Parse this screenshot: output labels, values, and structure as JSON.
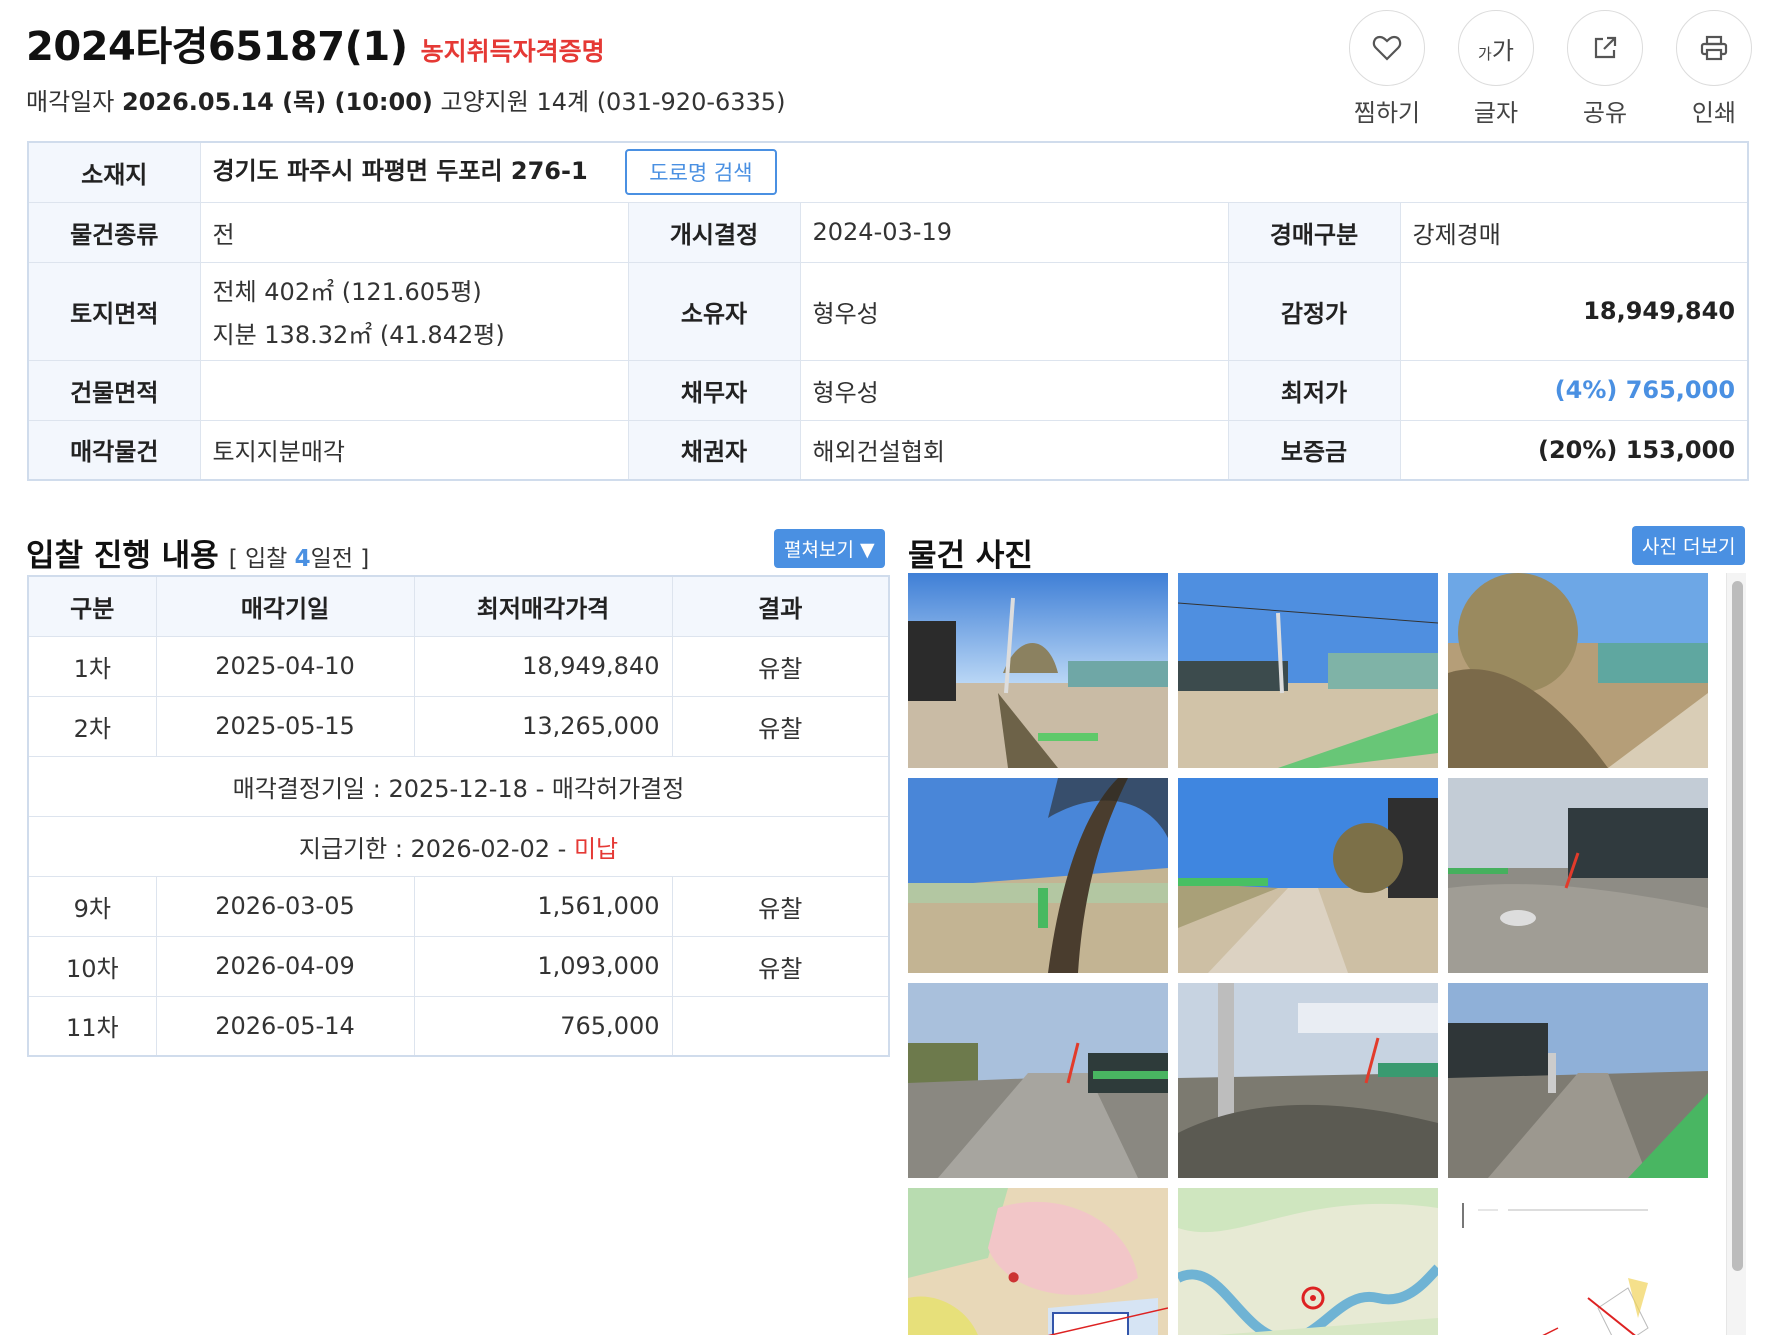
{
  "header": {
    "case_number": "2024타경65187(1)",
    "badge": "농지취득자격증명",
    "date_label": "매각일자",
    "date_value": "2026.05.14 (목) (10:00)",
    "court": "고양지원 14계 (031-920-6335)"
  },
  "actions": [
    {
      "label": "찜하기",
      "icon": "heart-icon"
    },
    {
      "label": "글자",
      "icon": "font-size-icon",
      "glyph_small": "가",
      "glyph_large": "가"
    },
    {
      "label": "공유",
      "icon": "share-icon"
    },
    {
      "label": "인쇄",
      "icon": "print-icon"
    }
  ],
  "info": {
    "location_label": "소재지",
    "location_value": "경기도 파주시 파평면 두포리 276-1",
    "road_search": "도로명 검색",
    "rows": [
      {
        "k1": "물건종류",
        "v1": "전",
        "k2": "개시결정",
        "v2": "2024-03-19",
        "k3": "경매구분",
        "v3": "강제경매"
      },
      {
        "k1": "토지면적",
        "v1": "전체 402㎡ (121.605평)",
        "v1b": "지분 138.32㎡ (41.842평)",
        "k2": "소유자",
        "v2": "형우성",
        "k3": "감정가",
        "v3": "18,949,840"
      },
      {
        "k1": "건물면적",
        "v1": "",
        "k2": "채무자",
        "v2": "형우성",
        "k3": "최저가",
        "v3": "(4%) 765,000"
      },
      {
        "k1": "매각물건",
        "v1": "토지지분매각",
        "k2": "채권자",
        "v2": "해외건설협회",
        "k3": "보증금",
        "v3": "(20%) 153,000"
      }
    ]
  },
  "bids": {
    "title": "입찰 진행 내용",
    "sub_prefix": "[ 입찰 ",
    "sub_count": "4",
    "sub_suffix": "일전 ]",
    "expand_button": "펼쳐보기 ▼",
    "headers": [
      "구분",
      "매각기일",
      "최저매각가격",
      "결과"
    ],
    "rows_top": [
      {
        "round": "1차",
        "date": "2025-04-10",
        "price": "18,949,840",
        "result": "유찰"
      },
      {
        "round": "2차",
        "date": "2025-05-15",
        "price": "13,265,000",
        "result": "유찰"
      }
    ],
    "decision_note": "매각결정기일 : 2025-12-18 - 매각허가결정",
    "payment_note_prefix": "지급기한 : 2026-02-02 - ",
    "payment_note_status": "미납",
    "rows_bottom": [
      {
        "round": "9차",
        "date": "2026-03-05",
        "price": "1,561,000",
        "result": "유찰"
      },
      {
        "round": "10차",
        "date": "2026-04-09",
        "price": "1,093,000",
        "result": "유찰"
      },
      {
        "round": "11차",
        "date": "2026-05-14",
        "price": "765,000",
        "result": ""
      }
    ]
  },
  "photos": {
    "title": "물건 사진",
    "more_button": "사진 더보기",
    "items": [
      {
        "kind": "field-photo"
      },
      {
        "kind": "field-photo"
      },
      {
        "kind": "field-photo"
      },
      {
        "kind": "field-photo"
      },
      {
        "kind": "field-photo"
      },
      {
        "kind": "field-photo"
      },
      {
        "kind": "road-photo"
      },
      {
        "kind": "road-photo"
      },
      {
        "kind": "road-photo"
      },
      {
        "kind": "map-image"
      },
      {
        "kind": "map-image"
      },
      {
        "kind": "site-plan-image"
      }
    ]
  },
  "colors": {
    "accent": "#4a90e2",
    "alert": "#e53935",
    "header_bg": "#f3f7fd"
  }
}
